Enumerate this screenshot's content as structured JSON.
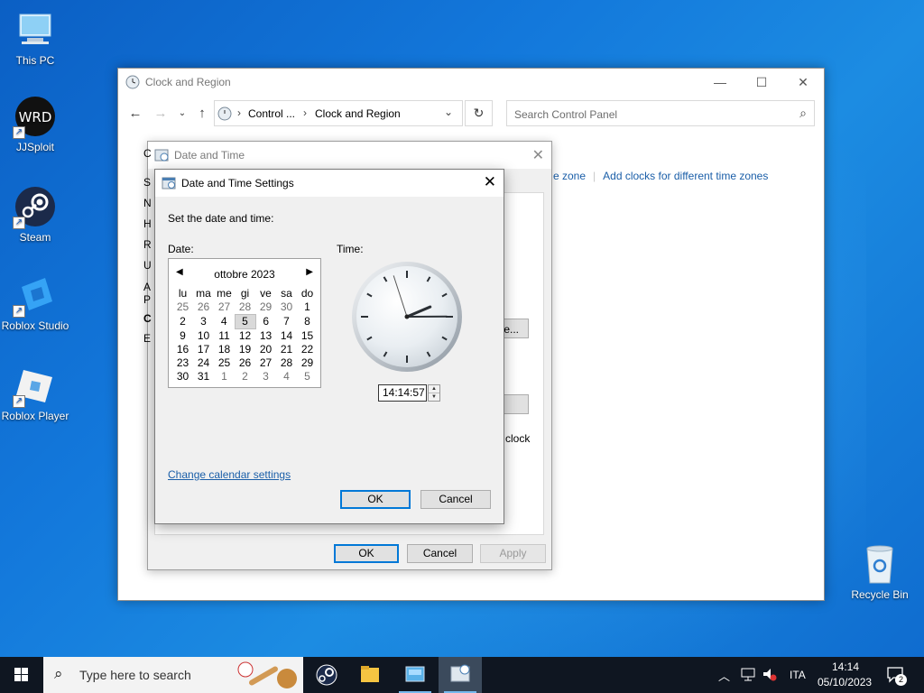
{
  "desktop": {
    "icons": [
      {
        "label": "This PC"
      },
      {
        "label": "JJSploit",
        "text": "WRD"
      },
      {
        "label": "Steam"
      },
      {
        "label": "Roblox Studio"
      },
      {
        "label": "Roblox Player"
      },
      {
        "label": "Recycle Bin"
      }
    ]
  },
  "control_panel": {
    "title": "Clock and Region",
    "breadcrumb": [
      "Control ...",
      "Clock and Region"
    ],
    "search_placeholder": "Search Control Panel",
    "links": [
      "e zone",
      "Add clocks for different time zones"
    ]
  },
  "date_time_dialog": {
    "title": "Date and Time",
    "partial_left_letters": [
      "C",
      "S",
      "N",
      "H",
      "R",
      "U",
      "A",
      "P",
      "C",
      "E"
    ],
    "partial_button_text": "e...",
    "partial_clock_text": "clock",
    "ok_label": "OK",
    "cancel_label": "Cancel",
    "apply_label": "Apply"
  },
  "settings_dialog": {
    "title": "Date and Time Settings",
    "instruction": "Set the date and time:",
    "date_label": "Date:",
    "time_label": "Time:",
    "calendar": {
      "month_label": "ottobre 2023",
      "weekdays": [
        "lu",
        "ma",
        "me",
        "gi",
        "ve",
        "sa",
        "do"
      ],
      "weeks": [
        [
          "25",
          "26",
          "27",
          "28",
          "29",
          "30",
          "1"
        ],
        [
          "2",
          "3",
          "4",
          "5",
          "6",
          "7",
          "8"
        ],
        [
          "9",
          "10",
          "11",
          "12",
          "13",
          "14",
          "15"
        ],
        [
          "16",
          "17",
          "18",
          "19",
          "20",
          "21",
          "22"
        ],
        [
          "23",
          "24",
          "25",
          "26",
          "27",
          "28",
          "29"
        ],
        [
          "30",
          "31",
          "1",
          "2",
          "3",
          "4",
          "5"
        ]
      ],
      "selected_day": "5"
    },
    "time_value": "14:14:57",
    "clock": {
      "hours": 14,
      "minutes": 14,
      "seconds": 57
    },
    "change_calendar_link": "Change calendar settings",
    "ok_label": "OK",
    "cancel_label": "Cancel"
  },
  "taskbar": {
    "search_placeholder": "Type here to search",
    "language": "ITA",
    "time": "14:14",
    "date": "05/10/2023",
    "notification_count": "2"
  },
  "colors": {
    "accent": "#0078d7",
    "link": "#1a5ea8",
    "taskbar": "#0f1621"
  }
}
